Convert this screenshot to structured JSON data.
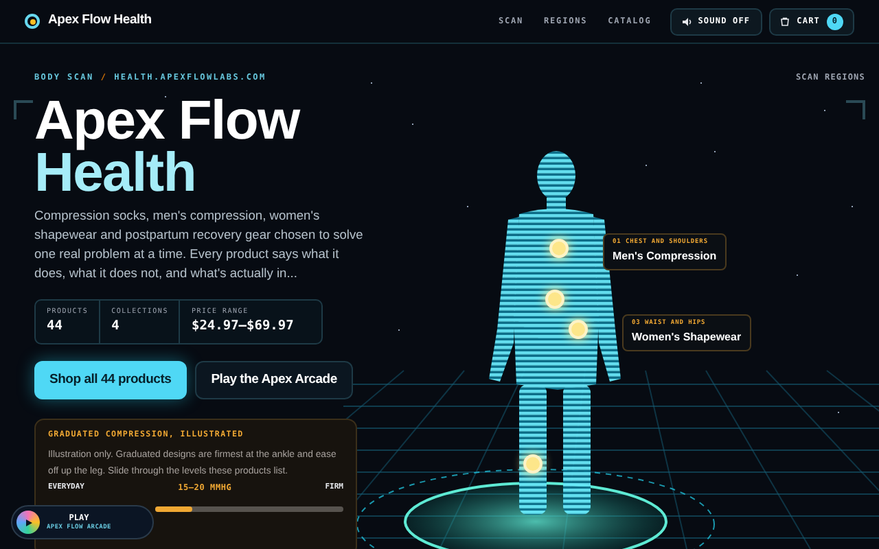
{
  "header": {
    "brand": "Apex Flow Health",
    "nav": [
      {
        "label": "SCAN"
      },
      {
        "label": "REGIONS"
      },
      {
        "label": "CATALOG"
      }
    ],
    "sound_button": "SOUND OFF",
    "cart_button": {
      "label": "CART",
      "count": "0"
    }
  },
  "breadcrumb": {
    "section": "BODY SCAN",
    "separator": "/",
    "domain": "HEALTH.APEXFLOWLABS.COM"
  },
  "scan_regions_label": "SCAN REGIONS",
  "hero": {
    "title_line_1": "Apex Flow",
    "title_line_2": "Health",
    "description": "Compression socks, men's compression, women's shapewear and postpartum recovery gear chosen to solve one real problem at a time. Every product says what it does, what it does not, and what's actually in..."
  },
  "stats": [
    {
      "label": "PRODUCTS",
      "value": "44"
    },
    {
      "label": "COLLECTIONS",
      "value": "4"
    },
    {
      "label": "PRICE RANGE",
      "value": "$24.97–$69.97"
    }
  ],
  "buttons": [
    {
      "label": "Shop all 44 products",
      "kind": "primary"
    },
    {
      "label": "Play the Apex Arcade",
      "kind": "secondary"
    }
  ],
  "compression_card": {
    "title": "GRADUATED COMPRESSION, ILLUSTRATED",
    "text": "Illustration only. Graduated designs are firmest at the ankle and ease off up the leg. Slide through the levels these products list.",
    "left_label": "EVERYDAY",
    "reading": "15–20 MMHG",
    "right_label": "FIRM",
    "level": 0.2
  },
  "regions": [
    {
      "tag": "01 CHEST AND SHOULDERS",
      "name": "Men's Compression"
    },
    {
      "tag": "03 WAIST AND HIPS",
      "name": "Women's Shapewear"
    }
  ],
  "arcade_button": {
    "label": "PLAY",
    "sublabel": "APEX FLOW ARCADE"
  }
}
